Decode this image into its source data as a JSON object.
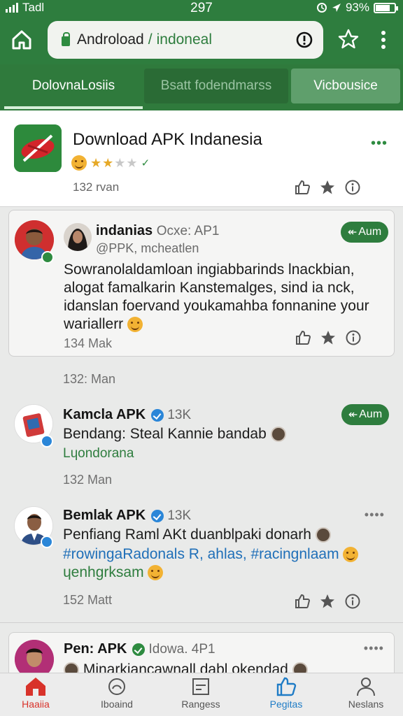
{
  "status_bar": {
    "carrier": "Tadl",
    "time": "297",
    "battery": "93%"
  },
  "browser": {
    "domain": "Androload",
    "separator": "/",
    "path": "indoneal"
  },
  "tabs": [
    {
      "label": "DolovnaLosiis"
    },
    {
      "label": "Bsatt fodendmarss"
    },
    {
      "label": "Vicbousice"
    }
  ],
  "app": {
    "title": "Download APK Indanesia",
    "meta": "132 rvan",
    "rating": 2,
    "max_rating": 5
  },
  "posts": [
    {
      "name": "indanias",
      "meta": "Ocxe: AP1",
      "handle": "@PPK, mcheatlen",
      "follow": "Aum",
      "text": "Sowranolaldamloan ingiabbarinds lnackbian, alogat famalkarin Kanstemalges, sind ia nck, idanslan foervand youkamahba fonnanine your wariallerr",
      "stat": "134  Mak"
    },
    {
      "stat_only": "132: Man"
    },
    {
      "name": "Kamcla APK",
      "meta": "13K",
      "follow": "Aum",
      "line1": "Bendang: Steal Kannie bandab",
      "line2": "Lɥondorana",
      "stat": "132  Man"
    },
    {
      "name": "Bemlak APK",
      "meta": "13K",
      "line1": "Penfiang Raml AKt duanblpaki donarh",
      "line2": "#rowingaRadonals R, ahlas, #racingnlaam",
      "line3": "ɥenhgrksam",
      "stat": "152  Matt"
    },
    {
      "name": "Pen: APK",
      "meta": "Idowa. 4P1",
      "line1": "Minarkiancawnall dabl okendad"
    }
  ],
  "bottom_nav": [
    {
      "label": "Haaiia"
    },
    {
      "label": "Iboaind"
    },
    {
      "label": "Rangess"
    },
    {
      "label": "Pegitas"
    },
    {
      "label": "Neslans"
    }
  ],
  "colors": {
    "primary": "#2e7d3e",
    "accent": "#d8322a",
    "link": "#1f6fb8"
  }
}
